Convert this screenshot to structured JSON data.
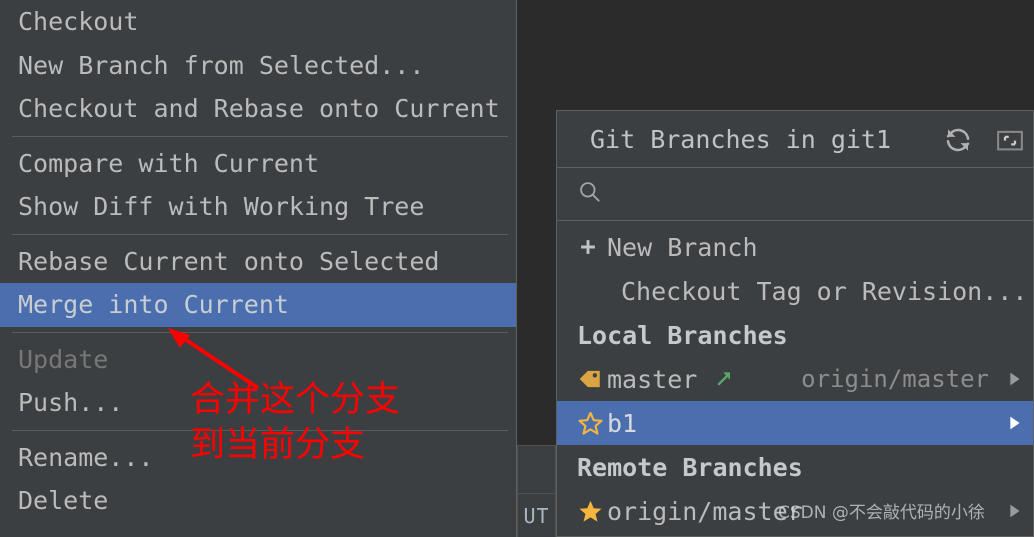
{
  "context_menu": {
    "groups": [
      {
        "items": [
          {
            "label": "Checkout",
            "state": "normal"
          },
          {
            "label": "New Branch from Selected...",
            "state": "normal"
          },
          {
            "label": "Checkout and Rebase onto Current",
            "state": "normal"
          }
        ]
      },
      {
        "items": [
          {
            "label": "Compare with Current",
            "state": "normal"
          },
          {
            "label": "Show Diff with Working Tree",
            "state": "normal"
          }
        ]
      },
      {
        "items": [
          {
            "label": "Rebase Current onto Selected",
            "state": "normal"
          },
          {
            "label": "Merge into Current",
            "state": "selected"
          }
        ]
      },
      {
        "items": [
          {
            "label": "Update",
            "state": "disabled"
          },
          {
            "label": "Push...",
            "state": "normal"
          }
        ]
      },
      {
        "items": [
          {
            "label": "Rename...",
            "state": "normal"
          },
          {
            "label": "Delete",
            "state": "normal"
          }
        ]
      }
    ]
  },
  "git_popup": {
    "title": "Git Branches in git1",
    "refresh_icon": "refresh-icon",
    "restore_icon": "restore-window-icon",
    "search": {
      "icon": "search-icon",
      "value": "",
      "placeholder": ""
    },
    "actions": [
      {
        "label": "New Branch",
        "icon": "plus-icon"
      },
      {
        "label": "Checkout Tag or Revision...",
        "icon": ""
      }
    ],
    "sections": [
      {
        "header": "Local Branches",
        "branches": [
          {
            "name": "master",
            "icon": "tag-icon",
            "status_icon": "green-arrow-up-icon",
            "tracking": "origin/master",
            "selected": false,
            "submenu_arrow": "chevron-right-icon"
          },
          {
            "name": "b1",
            "icon": "star-outline-icon",
            "status_icon": "",
            "tracking": "",
            "selected": true,
            "submenu_arrow": "chevron-right-icon"
          }
        ]
      },
      {
        "header": "Remote Branches",
        "branches": [
          {
            "name": "origin/master",
            "icon": "star-filled-icon",
            "status_icon": "",
            "tracking": "",
            "selected": false,
            "submenu_arrow": "chevron-right-icon"
          }
        ]
      }
    ]
  },
  "background": {
    "status_text": "UT"
  },
  "annotation": {
    "line1": "合并这个分支",
    "line2": "到当前分支",
    "color": "#ff0000",
    "arrow": "red-arrow-pointer"
  },
  "watermark": {
    "text": "CSDN @不会敲代码的小徐"
  },
  "colors": {
    "menu_bg": "#3c3f41",
    "editor_bg": "#2b2b2b",
    "selection_blue": "#4b6eaf",
    "text": "#bbbbbb",
    "text_disabled": "#777777",
    "tag_orange": "#d9a441",
    "star_orange": "#f5b53f",
    "arrow_green": "#59a869",
    "annotation_red": "#ff0000"
  }
}
